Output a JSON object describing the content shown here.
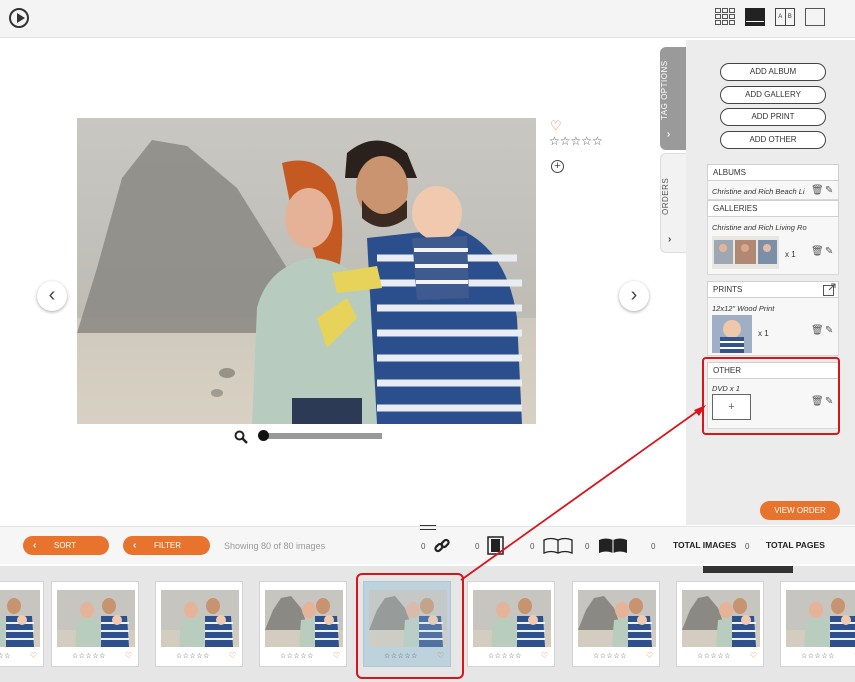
{
  "top_bar": {
    "view_icons": [
      "grid-view-icon",
      "spread-view-icon",
      "ab-compare-icon",
      "single-view-icon"
    ],
    "ab_letters": [
      "A",
      "B"
    ]
  },
  "viewer": {
    "rating_stars": "☆☆☆☆☆",
    "prev_arrow": "‹",
    "next_arrow": "›",
    "heart": "♡",
    "plus": "+"
  },
  "side_tabs": {
    "tag_options": "TAG OPTIONS",
    "orders": "ORDERS",
    "chevron": "›"
  },
  "orders_panel": {
    "buttons": [
      "ADD ALBUM",
      "ADD GALLERY",
      "ADD PRINT",
      "ADD OTHER"
    ],
    "albums": {
      "header": "ALBUMS",
      "item": "Christine and Rich Beach Li"
    },
    "galleries": {
      "header": "GALLERIES",
      "item": "Christine and Rich Living Ro",
      "qty": "x 1"
    },
    "prints": {
      "header": "PRINTS",
      "item": "12x12\" Wood Print",
      "qty": "x 1"
    },
    "other": {
      "header": "OTHER",
      "item": "DVD x 1",
      "add": "+"
    },
    "view_order": "VIEW ORDER"
  },
  "toolbar": {
    "sort": "SORT",
    "filter": "FILTER",
    "chevron": "‹",
    "showing": "Showing 80 of 80 images",
    "link_count": "0",
    "single_count": "0",
    "spread_count": "0",
    "album_count": "0",
    "total_images_count": "0",
    "total_images_label": "TOTAL IMAGES",
    "total_pages_count": "0",
    "total_pages_label": "TOTAL PAGES"
  },
  "filmstrip": {
    "card_stars": "☆☆☆☆☆",
    "card_heart": "♡",
    "selected_index": 4,
    "card_count": 9
  },
  "colors": {
    "accent_orange": "#e8732c",
    "highlight_red": "#d9151c",
    "panel_gray": "#ececec"
  }
}
